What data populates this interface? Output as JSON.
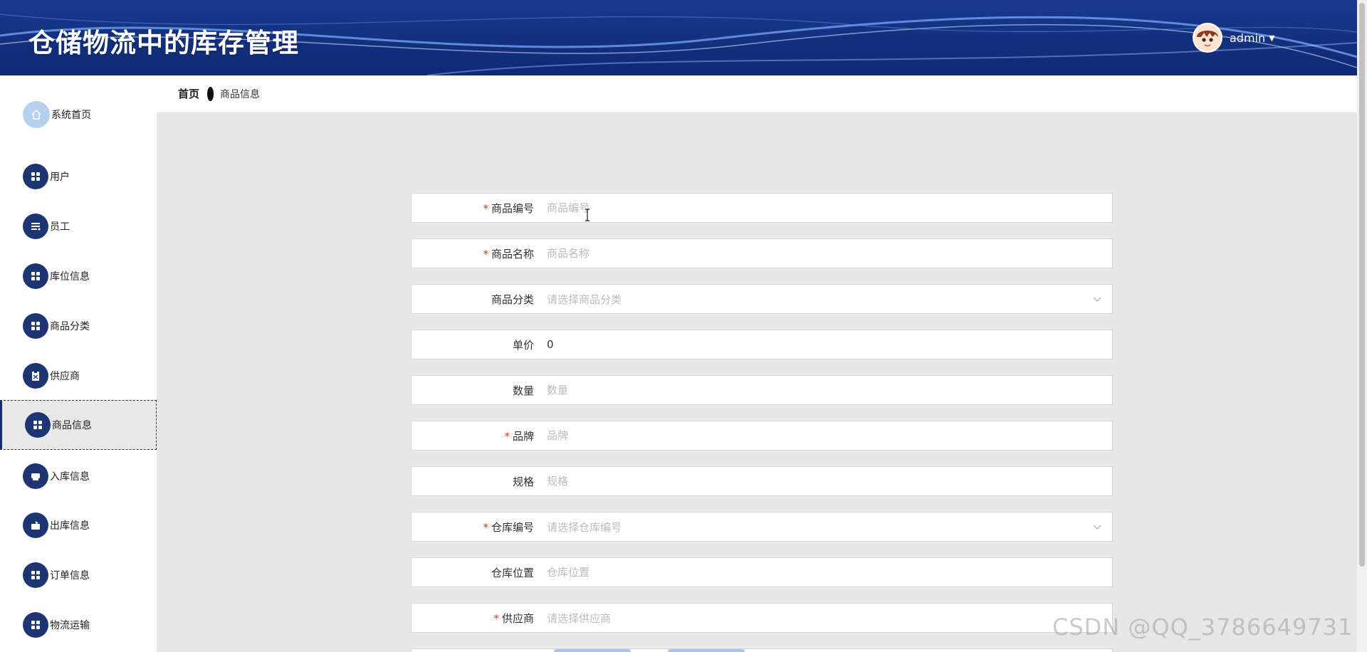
{
  "header": {
    "title": "仓储物流中的库存管理",
    "username": "admin",
    "caret": "▼"
  },
  "breadcrumb": {
    "home": "首页",
    "current": "商品信息"
  },
  "sidebar": {
    "items": [
      {
        "label": "系统首页",
        "icon": "home-icon"
      },
      {
        "label": "用户",
        "icon": "grid-icon"
      },
      {
        "label": "员工",
        "icon": "list-icon"
      },
      {
        "label": "库位信息",
        "icon": "grid-icon"
      },
      {
        "label": "商品分类",
        "icon": "grid-icon"
      },
      {
        "label": "供应商",
        "icon": "clipboard-icon"
      },
      {
        "label": "商品信息",
        "icon": "grid-icon",
        "active": true
      },
      {
        "label": "入库信息",
        "icon": "printer-icon"
      },
      {
        "label": "出库信息",
        "icon": "box-icon"
      },
      {
        "label": "订单信息",
        "icon": "grid-icon"
      },
      {
        "label": "物流运输",
        "icon": "grid-icon"
      }
    ]
  },
  "form": {
    "fields": [
      {
        "label": "商品编号",
        "required": true,
        "type": "text",
        "value": "",
        "placeholder": "商品编号"
      },
      {
        "label": "商品名称",
        "required": true,
        "type": "text",
        "value": "",
        "placeholder": "商品名称"
      },
      {
        "label": "商品分类",
        "required": false,
        "type": "select",
        "placeholder": "请选择商品分类"
      },
      {
        "label": "单价",
        "required": false,
        "type": "text",
        "value": "0",
        "placeholder": ""
      },
      {
        "label": "数量",
        "required": false,
        "type": "text",
        "value": "",
        "placeholder": "数量"
      },
      {
        "label": "品牌",
        "required": true,
        "type": "text",
        "value": "",
        "placeholder": "品牌"
      },
      {
        "label": "规格",
        "required": false,
        "type": "text",
        "value": "",
        "placeholder": "规格"
      },
      {
        "label": "仓库编号",
        "required": true,
        "type": "select",
        "placeholder": "请选择仓库编号"
      },
      {
        "label": "仓库位置",
        "required": false,
        "type": "text",
        "value": "",
        "placeholder": "仓库位置"
      },
      {
        "label": "供应商",
        "required": true,
        "type": "select",
        "placeholder": "请选择供应商"
      }
    ],
    "required_mark": "*"
  },
  "watermark": "CSDN @QQ_3786649731",
  "colors": {
    "header_bg": "#13307e",
    "menu_icon_bg": "#1e3574",
    "home_icon_bg": "#b6d1f0",
    "content_bg": "#e7e7e7",
    "required": "#e33333"
  }
}
